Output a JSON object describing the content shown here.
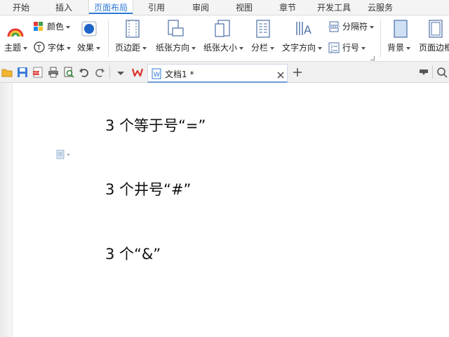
{
  "menu": {
    "tabs": [
      {
        "label": "开始"
      },
      {
        "label": "插入"
      },
      {
        "label": "页面布局",
        "active": true
      },
      {
        "label": "引用"
      },
      {
        "label": "审阅"
      },
      {
        "label": "视图"
      },
      {
        "label": "章节"
      },
      {
        "label": "开发工具"
      },
      {
        "label": "云服务"
      }
    ]
  },
  "ribbon": {
    "theme": "主题",
    "color": "颜色",
    "font": "字体",
    "effect": "效果",
    "margins": "页边距",
    "orientation": "纸张方向",
    "size": "纸张大小",
    "columns": "分栏",
    "text_direction": "文字方向",
    "breaks": "分隔符",
    "line_numbers": "行号",
    "background": "背景",
    "page_border": "页面边框"
  },
  "document_tab": {
    "title": "文档1 *"
  },
  "document": {
    "lines": [
      "3 个等于号“=”",
      "3 个井号“#”",
      "3 个“&”"
    ]
  },
  "colors": {
    "accent": "#2b79d3",
    "wps_red": "#d9342b"
  }
}
